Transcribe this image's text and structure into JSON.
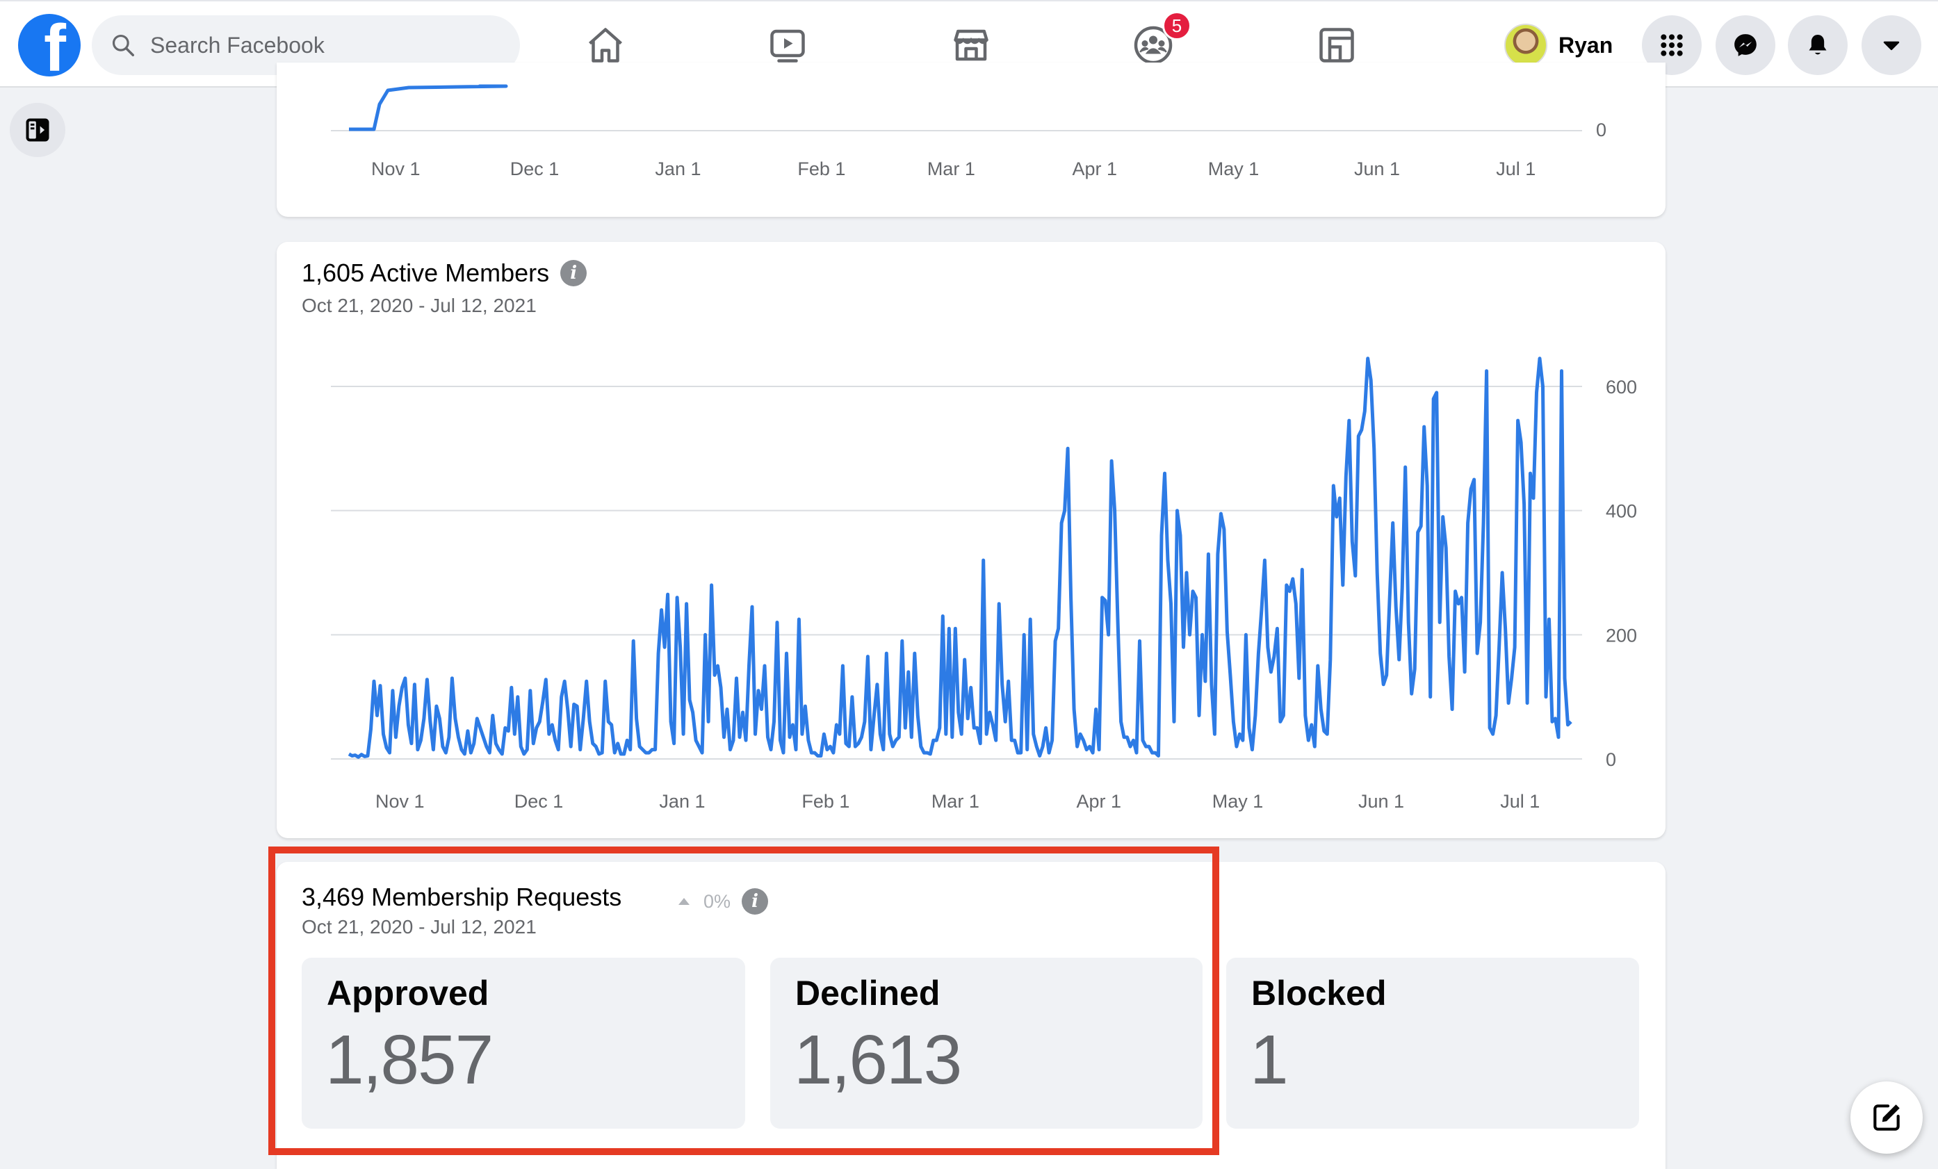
{
  "nav": {
    "search_placeholder": "Search Facebook",
    "notification_badge": "5",
    "profile_name": "Ryan"
  },
  "chart_top": {
    "chart_data": {
      "type": "line",
      "x_tick_labels": [
        "Nov 1",
        "Dec 1",
        "Jan 1",
        "Feb 1",
        "Mar 1",
        "Apr 1",
        "May 1",
        "Jun 1",
        "Jul 1"
      ],
      "y_tick_labels": [
        "0"
      ],
      "color": "#2d7be5"
    }
  },
  "active_members": {
    "title": "1,605 Active Members",
    "date_range": "Oct 21, 2020 - Jul 12, 2021",
    "chart_data": {
      "type": "line",
      "x_tick_labels": [
        "Nov 1",
        "Dec 1",
        "Jan 1",
        "Feb 1",
        "Mar 1",
        "Apr 1",
        "May 1",
        "Jun 1",
        "Jul 1"
      ],
      "y_tick_labels": [
        "0",
        "200",
        "400",
        "600"
      ],
      "ylim": [
        0,
        600
      ],
      "color": "#2d7be5",
      "grid": true,
      "series_start": "Oct 21, 2020",
      "series_end": "Jul 12, 2021",
      "values": [
        8,
        5,
        6,
        3,
        7,
        4,
        5,
        48,
        125,
        70,
        118,
        40,
        18,
        10,
        110,
        35,
        85,
        115,
        130,
        55,
        25,
        120,
        15,
        30,
        65,
        128,
        60,
        15,
        85,
        65,
        20,
        10,
        35,
        130,
        65,
        35,
        15,
        8,
        45,
        10,
        25,
        65,
        50,
        35,
        20,
        10,
        70,
        25,
        15,
        8,
        50,
        45,
        115,
        40,
        100,
        20,
        8,
        15,
        110,
        25,
        50,
        60,
        92,
        128,
        40,
        55,
        30,
        15,
        100,
        125,
        80,
        20,
        88,
        85,
        15,
        65,
        125,
        60,
        25,
        20,
        8,
        10,
        125,
        60,
        55,
        10,
        25,
        8,
        8,
        30,
        15,
        190,
        65,
        20,
        15,
        10,
        10,
        15,
        15,
        170,
        240,
        180,
        265,
        60,
        25,
        260,
        180,
        40,
        250,
        95,
        75,
        30,
        20,
        10,
        200,
        60,
        280,
        135,
        150,
        115,
        35,
        80,
        15,
        30,
        130,
        35,
        75,
        30,
        150,
        245,
        40,
        110,
        80,
        150,
        35,
        15,
        60,
        220,
        30,
        10,
        170,
        35,
        55,
        15,
        225,
        40,
        85,
        30,
        10,
        10,
        5,
        5,
        40,
        15,
        20,
        10,
        55,
        40,
        150,
        25,
        20,
        100,
        20,
        25,
        35,
        60,
        165,
        15,
        70,
        120,
        40,
        15,
        170,
        40,
        20,
        30,
        35,
        190,
        50,
        140,
        35,
        170,
        70,
        20,
        10,
        10,
        8,
        30,
        30,
        50,
        230,
        40,
        210,
        35,
        210,
        75,
        40,
        160,
        65,
        115,
        50,
        50,
        25,
        320,
        40,
        75,
        55,
        30,
        250,
        120,
        60,
        125,
        30,
        30,
        10,
        10,
        200,
        15,
        225,
        40,
        20,
        5,
        20,
        50,
        10,
        30,
        190,
        210,
        380,
        400,
        500,
        260,
        80,
        20,
        40,
        30,
        15,
        20,
        10,
        80,
        15,
        260,
        255,
        200,
        480,
        400,
        220,
        60,
        35,
        35,
        20,
        30,
        10,
        190,
        30,
        20,
        20,
        10,
        10,
        5,
        360,
        460,
        320,
        250,
        60,
        400,
        360,
        180,
        300,
        200,
        270,
        260,
        70,
        200,
        125,
        330,
        120,
        40,
        330,
        395,
        370,
        205,
        135,
        60,
        20,
        40,
        30,
        200,
        50,
        15,
        70,
        170,
        240,
        320,
        180,
        140,
        165,
        210,
        60,
        70,
        280,
        270,
        290,
        250,
        130,
        305,
        70,
        30,
        55,
        20,
        150,
        80,
        45,
        40,
        160,
        440,
        390,
        420,
        280,
        455,
        545,
        350,
        295,
        520,
        530,
        560,
        645,
        610,
        500,
        300,
        170,
        120,
        135,
        260,
        380,
        245,
        160,
        275,
        470,
        220,
        105,
        145,
        365,
        375,
        535,
        440,
        100,
        580,
        590,
        220,
        390,
        340,
        165,
        80,
        270,
        250,
        260,
        140,
        380,
        435,
        450,
        170,
        220,
        380,
        625,
        50,
        40,
        70,
        180,
        300,
        210,
        90,
        130,
        180,
        545,
        510,
        410,
        90,
        460,
        420,
        590,
        645,
        600,
        100,
        225,
        60,
        65,
        35,
        625,
        130,
        55,
        60
      ]
    }
  },
  "membership": {
    "title": "3,469 Membership Requests",
    "trend": "0%",
    "date_range": "Oct 21, 2020 - Jul 12, 2021",
    "stats": [
      {
        "label": "Approved",
        "value": "1,857"
      },
      {
        "label": "Declined",
        "value": "1,613"
      },
      {
        "label": "Blocked",
        "value": "1"
      }
    ]
  },
  "colors": {
    "accent": "#1877f2",
    "line": "#2d7be5",
    "highlight": "#e53a23",
    "badge": "#e41e3f"
  }
}
